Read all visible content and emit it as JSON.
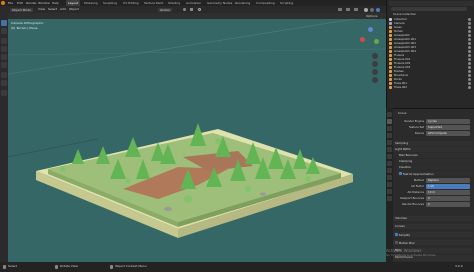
{
  "menubar": {
    "items": [
      "File",
      "Edit",
      "Render",
      "Window",
      "Help"
    ],
    "workspaces": [
      "Layout",
      "Modeling",
      "Sculpting",
      "UV Editing",
      "Texture Paint",
      "Shading",
      "Animation",
      "Geometry Nodes",
      "Rendering",
      "Compositing",
      "Scripting"
    ],
    "active_workspace": "Layout"
  },
  "viewport_header": {
    "mode": "Object Mode",
    "menus": [
      "View",
      "Select",
      "Add",
      "Object"
    ],
    "transform": "Global",
    "options": "Options"
  },
  "viewport": {
    "camera_label": "Camera Orthographic",
    "collection_label": "(0) Terrain | Plane"
  },
  "outliner": {
    "title": "Scene Collection",
    "items": [
      {
        "name": "Collection"
      },
      {
        "name": "Camera"
      },
      {
        "name": "Grass"
      },
      {
        "name": "Terrain"
      },
      {
        "name": "Grassplatch"
      },
      {
        "name": "Grassplatch.001"
      },
      {
        "name": "Grassplatch.002"
      },
      {
        "name": "Grassplatch.003"
      },
      {
        "name": "Grassplatch.004"
      },
      {
        "name": "Flowers"
      },
      {
        "name": "Flowers.001"
      },
      {
        "name": "Flowers.002"
      },
      {
        "name": "Flowers.003"
      },
      {
        "name": "Bushes"
      },
      {
        "name": "Mountains"
      },
      {
        "name": "Rocks"
      },
      {
        "name": "Trees.001"
      },
      {
        "name": "Trees.002"
      }
    ]
  },
  "properties": {
    "scene_name": "Scene",
    "render_engine_label": "Render Engine",
    "render_engine": "Cycles",
    "feature_set_label": "Feature Set",
    "feature_set": "Supported",
    "device_label": "Device",
    "device": "GPU Compute",
    "sections": {
      "sampling": "Sampling",
      "light_paths": "Light Paths",
      "max_bounces": "Max Bounces",
      "clamping": "Clamping",
      "caustics": "Caustics",
      "fast_gi": "Fast GI Approximation",
      "volumes": "Volumes",
      "curves": "Curves",
      "simplify": "Simplify",
      "motion_blur": "Motion Blur",
      "film": "Film",
      "performance": "Performance"
    },
    "fast_gi_rows": [
      {
        "label": "Method",
        "value": "Replace"
      },
      {
        "label": "AO Factor",
        "value": "1.00"
      },
      {
        "label": "AO Distance",
        "value": "10 m"
      },
      {
        "label": "Viewport Bounces",
        "value": "0"
      },
      {
        "label": "Render Bounces",
        "value": "0"
      }
    ]
  },
  "statusbar": {
    "select": "Select",
    "box_select": "Rotate View",
    "menu": "Object Context Menu",
    "watermark_title": "Activate Windows",
    "watermark_sub": "Go to Settings to activate Windows.",
    "version": "3.0.0"
  },
  "colors": {
    "viewport_bg": "#356766",
    "accent": "#4a7bbd",
    "tree": "#6fbf5c",
    "terrain_side": "#d8dca2"
  }
}
